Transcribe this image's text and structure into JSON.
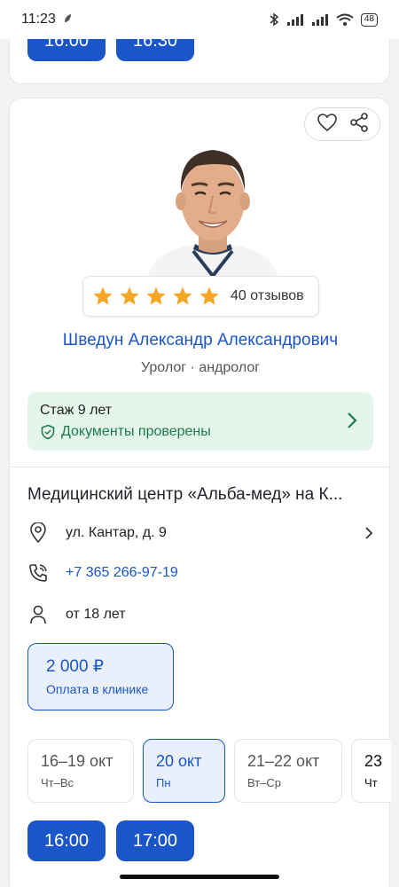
{
  "status": {
    "time": "11:23",
    "battery": "48"
  },
  "prev_card": {
    "slots": [
      "16:00",
      "16:30"
    ]
  },
  "doctor": {
    "rating_stars": 5,
    "reviews": "40 отзывов",
    "name": "Шведун Александр Александрович",
    "specialty": "Уролог · андролог",
    "experience": "Стаж 9 лет",
    "verified": "Документы проверены"
  },
  "clinic": {
    "name": "Медицинский центр «Альба-мед» на К...",
    "address": "ул. Кантар, д. 9",
    "phone": "+7 365 266-97-19",
    "age": "от 18 лет"
  },
  "price": {
    "value": "2 000 ₽",
    "note": "Оплата в клинике"
  },
  "dates": [
    {
      "main": "16–19 окт",
      "sub": "Чт–Вс"
    },
    {
      "main": "20 окт",
      "sub": "Пн"
    },
    {
      "main": "21–22 окт",
      "sub": "Вт–Ср"
    },
    {
      "main": "23",
      "sub": "Чт"
    }
  ],
  "slots": [
    "16:00",
    "17:00"
  ],
  "colors": {
    "accent": "#1a56c8",
    "verified_bg": "#e4f5ec",
    "verified_text": "#1f7a49",
    "star": "#f5a623"
  }
}
